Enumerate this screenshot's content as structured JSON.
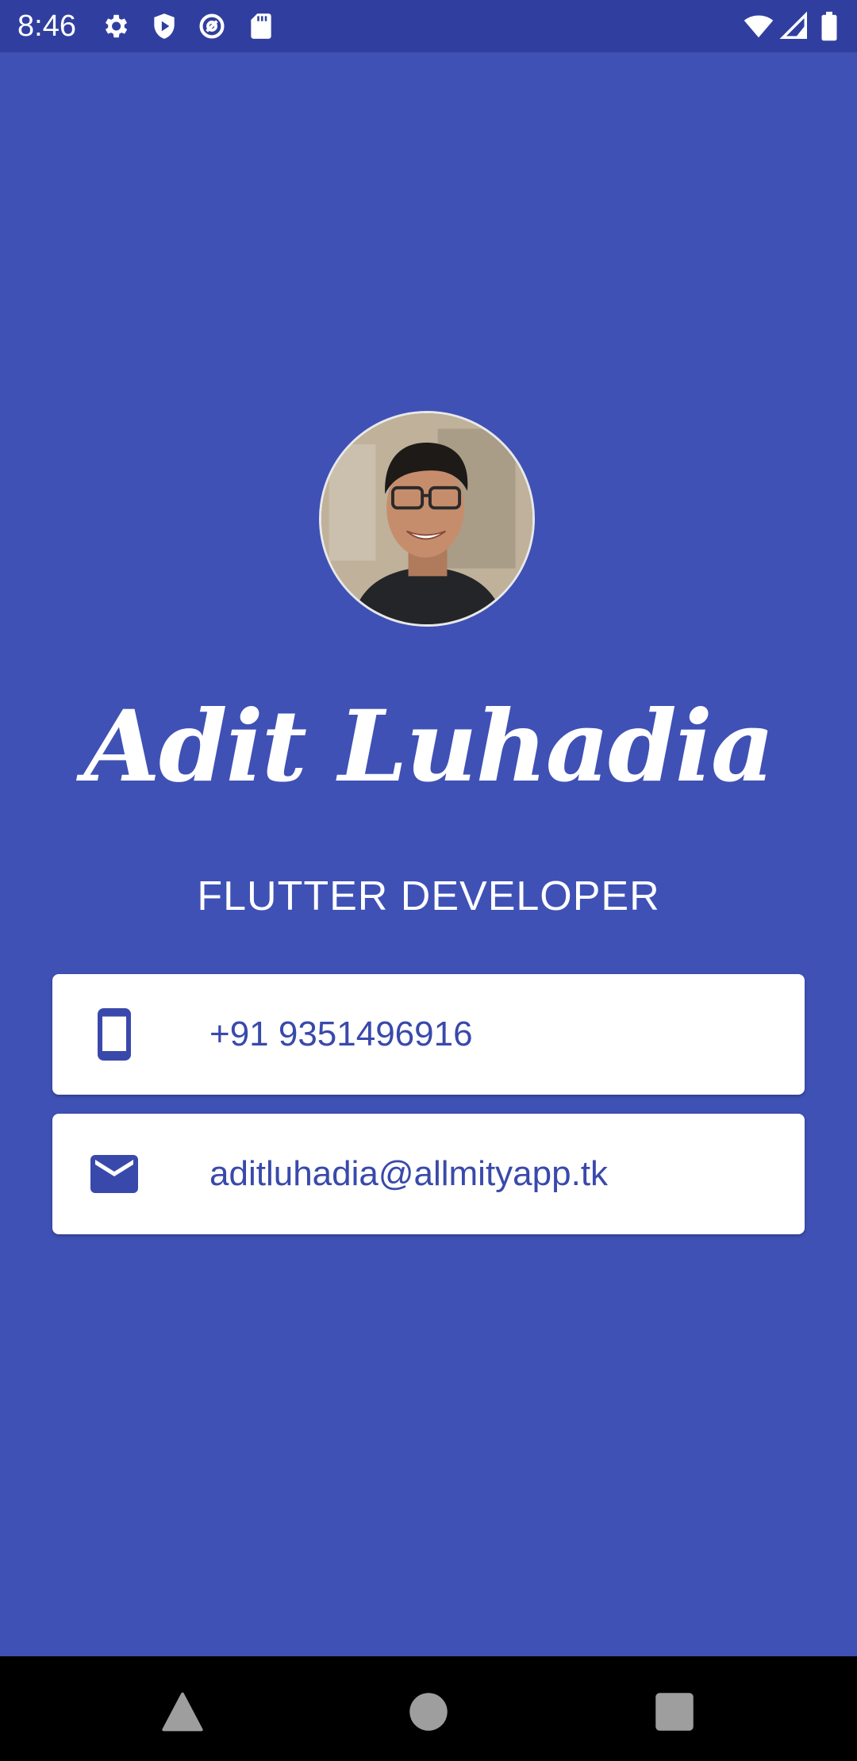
{
  "status_bar": {
    "time": "8:46",
    "left_icons": [
      "gear-icon",
      "play-protect-icon",
      "data-saver-icon",
      "sd-card-icon"
    ],
    "right_icons": [
      "wifi-icon",
      "cell-signal-icon",
      "battery-icon"
    ]
  },
  "profile": {
    "name": "Adit Luhadia",
    "title": "FLUTTER DEVELOPER"
  },
  "contacts": [
    {
      "icon": "phone-icon",
      "value": "+91 9351496916"
    },
    {
      "icon": "mail-icon",
      "value": "aditluhadia@allmityapp.tk"
    }
  ],
  "nav_bar": {
    "buttons": [
      "back-icon",
      "home-icon",
      "recents-icon"
    ]
  },
  "colors": {
    "background": "#3f51b5",
    "status_bar": "#303f9f",
    "accent": "#3949ab",
    "card": "#ffffff"
  }
}
